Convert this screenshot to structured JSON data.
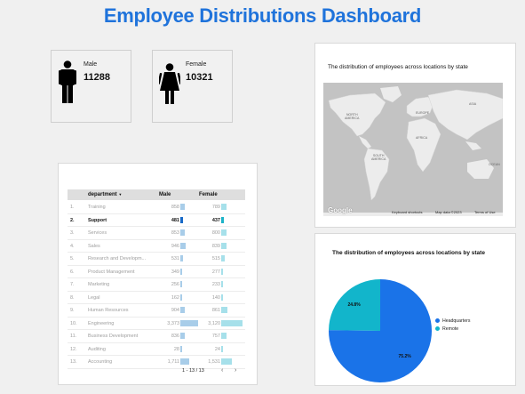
{
  "dashboard": {
    "title": "Employee Distributions Dashboard"
  },
  "kpis": {
    "male": {
      "label": "Male",
      "value": "11288",
      "icon": "male-person-icon"
    },
    "female": {
      "label": "Female",
      "value": "10321",
      "icon": "female-person-icon"
    }
  },
  "map_chart": {
    "title": "The distribution of employees across locations by state",
    "labels": {
      "north_america": "NORTH\nAMERICA",
      "europe": "EUROPE",
      "asia": "ASIA",
      "africa": "AFRICA",
      "south_america": "SOUTH\nAMERICA",
      "ocean": "OCEAN"
    },
    "footer": {
      "logo": "Google",
      "shortcuts": "Keyboard shortcuts",
      "map_data": "Map data ©2023",
      "terms": "Terms of Use"
    }
  },
  "table": {
    "headers": {
      "department": "department",
      "sort_indicator": "▼",
      "male": "Male",
      "female": "Female"
    },
    "rows": [
      {
        "no": "1.",
        "department": "Training",
        "male": "858",
        "female": "789",
        "male_value": 858,
        "female_value": 789
      },
      {
        "no": "2.",
        "department": "Support",
        "male": "481",
        "female": "437",
        "male_value": 481,
        "female_value": 437,
        "selected": true
      },
      {
        "no": "3.",
        "department": "Services",
        "male": "853",
        "female": "800",
        "male_value": 853,
        "female_value": 800
      },
      {
        "no": "4.",
        "department": "Sales",
        "male": "946",
        "female": "839",
        "male_value": 946,
        "female_value": 839
      },
      {
        "no": "5.",
        "department": "Research and Developm...",
        "male": "531",
        "female": "515",
        "male_value": 531,
        "female_value": 515
      },
      {
        "no": "6.",
        "department": "Product Management",
        "male": "349",
        "female": "277",
        "male_value": 349,
        "female_value": 277
      },
      {
        "no": "7.",
        "department": "Marketing",
        "male": "256",
        "female": "233",
        "male_value": 256,
        "female_value": 233
      },
      {
        "no": "8.",
        "department": "Legal",
        "male": "162",
        "female": "140",
        "male_value": 162,
        "female_value": 140
      },
      {
        "no": "9.",
        "department": "Human Resources",
        "male": "904",
        "female": "861",
        "male_value": 904,
        "female_value": 861
      },
      {
        "no": "10.",
        "department": "Engineering",
        "male": "3,373",
        "female": "3,120",
        "male_value": 3373,
        "female_value": 3120
      },
      {
        "no": "11.",
        "department": "Business Development",
        "male": "836",
        "female": "757",
        "male_value": 836,
        "female_value": 757
      },
      {
        "no": "12.",
        "department": "Auditing",
        "male": "28",
        "female": "24",
        "male_value": 28,
        "female_value": 24
      },
      {
        "no": "13.",
        "department": "Accounting",
        "male": "1,711",
        "female": "1,531",
        "male_value": 1711,
        "female_value": 1531
      }
    ],
    "pager": {
      "range": "1 - 13 / 13",
      "prev": "‹",
      "next": "›"
    },
    "colors": {
      "male_bar": "#a8cde9",
      "female_bar": "#a6e0ea",
      "selected_male_bar": "#1769c7",
      "selected_female_bar": "#1cb3c8"
    }
  },
  "chart_data": {
    "type": "pie",
    "title": "The distribution of employees across locations by state",
    "slices": [
      {
        "name": "Headquarters",
        "value": 75.2,
        "label": "75.2%",
        "color": "#1a73e8"
      },
      {
        "name": "Remote",
        "value": 24.8,
        "label": "24.8%",
        "color": "#12b5cb"
      }
    ],
    "legend": "right"
  }
}
